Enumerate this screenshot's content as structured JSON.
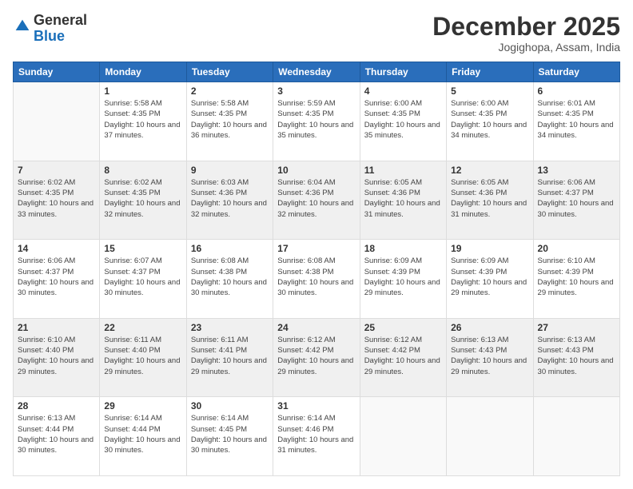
{
  "header": {
    "logo_line1": "General",
    "logo_line2": "Blue",
    "month": "December 2025",
    "location": "Jogighopa, Assam, India"
  },
  "days_of_week": [
    "Sunday",
    "Monday",
    "Tuesday",
    "Wednesday",
    "Thursday",
    "Friday",
    "Saturday"
  ],
  "weeks": [
    [
      {
        "num": "",
        "sunrise": "",
        "sunset": "",
        "daylight": ""
      },
      {
        "num": "1",
        "sunrise": "Sunrise: 5:58 AM",
        "sunset": "Sunset: 4:35 PM",
        "daylight": "Daylight: 10 hours and 37 minutes."
      },
      {
        "num": "2",
        "sunrise": "Sunrise: 5:58 AM",
        "sunset": "Sunset: 4:35 PM",
        "daylight": "Daylight: 10 hours and 36 minutes."
      },
      {
        "num": "3",
        "sunrise": "Sunrise: 5:59 AM",
        "sunset": "Sunset: 4:35 PM",
        "daylight": "Daylight: 10 hours and 35 minutes."
      },
      {
        "num": "4",
        "sunrise": "Sunrise: 6:00 AM",
        "sunset": "Sunset: 4:35 PM",
        "daylight": "Daylight: 10 hours and 35 minutes."
      },
      {
        "num": "5",
        "sunrise": "Sunrise: 6:00 AM",
        "sunset": "Sunset: 4:35 PM",
        "daylight": "Daylight: 10 hours and 34 minutes."
      },
      {
        "num": "6",
        "sunrise": "Sunrise: 6:01 AM",
        "sunset": "Sunset: 4:35 PM",
        "daylight": "Daylight: 10 hours and 34 minutes."
      }
    ],
    [
      {
        "num": "7",
        "sunrise": "Sunrise: 6:02 AM",
        "sunset": "Sunset: 4:35 PM",
        "daylight": "Daylight: 10 hours and 33 minutes."
      },
      {
        "num": "8",
        "sunrise": "Sunrise: 6:02 AM",
        "sunset": "Sunset: 4:35 PM",
        "daylight": "Daylight: 10 hours and 32 minutes."
      },
      {
        "num": "9",
        "sunrise": "Sunrise: 6:03 AM",
        "sunset": "Sunset: 4:36 PM",
        "daylight": "Daylight: 10 hours and 32 minutes."
      },
      {
        "num": "10",
        "sunrise": "Sunrise: 6:04 AM",
        "sunset": "Sunset: 4:36 PM",
        "daylight": "Daylight: 10 hours and 32 minutes."
      },
      {
        "num": "11",
        "sunrise": "Sunrise: 6:05 AM",
        "sunset": "Sunset: 4:36 PM",
        "daylight": "Daylight: 10 hours and 31 minutes."
      },
      {
        "num": "12",
        "sunrise": "Sunrise: 6:05 AM",
        "sunset": "Sunset: 4:36 PM",
        "daylight": "Daylight: 10 hours and 31 minutes."
      },
      {
        "num": "13",
        "sunrise": "Sunrise: 6:06 AM",
        "sunset": "Sunset: 4:37 PM",
        "daylight": "Daylight: 10 hours and 30 minutes."
      }
    ],
    [
      {
        "num": "14",
        "sunrise": "Sunrise: 6:06 AM",
        "sunset": "Sunset: 4:37 PM",
        "daylight": "Daylight: 10 hours and 30 minutes."
      },
      {
        "num": "15",
        "sunrise": "Sunrise: 6:07 AM",
        "sunset": "Sunset: 4:37 PM",
        "daylight": "Daylight: 10 hours and 30 minutes."
      },
      {
        "num": "16",
        "sunrise": "Sunrise: 6:08 AM",
        "sunset": "Sunset: 4:38 PM",
        "daylight": "Daylight: 10 hours and 30 minutes."
      },
      {
        "num": "17",
        "sunrise": "Sunrise: 6:08 AM",
        "sunset": "Sunset: 4:38 PM",
        "daylight": "Daylight: 10 hours and 30 minutes."
      },
      {
        "num": "18",
        "sunrise": "Sunrise: 6:09 AM",
        "sunset": "Sunset: 4:39 PM",
        "daylight": "Daylight: 10 hours and 29 minutes."
      },
      {
        "num": "19",
        "sunrise": "Sunrise: 6:09 AM",
        "sunset": "Sunset: 4:39 PM",
        "daylight": "Daylight: 10 hours and 29 minutes."
      },
      {
        "num": "20",
        "sunrise": "Sunrise: 6:10 AM",
        "sunset": "Sunset: 4:39 PM",
        "daylight": "Daylight: 10 hours and 29 minutes."
      }
    ],
    [
      {
        "num": "21",
        "sunrise": "Sunrise: 6:10 AM",
        "sunset": "Sunset: 4:40 PM",
        "daylight": "Daylight: 10 hours and 29 minutes."
      },
      {
        "num": "22",
        "sunrise": "Sunrise: 6:11 AM",
        "sunset": "Sunset: 4:40 PM",
        "daylight": "Daylight: 10 hours and 29 minutes."
      },
      {
        "num": "23",
        "sunrise": "Sunrise: 6:11 AM",
        "sunset": "Sunset: 4:41 PM",
        "daylight": "Daylight: 10 hours and 29 minutes."
      },
      {
        "num": "24",
        "sunrise": "Sunrise: 6:12 AM",
        "sunset": "Sunset: 4:42 PM",
        "daylight": "Daylight: 10 hours and 29 minutes."
      },
      {
        "num": "25",
        "sunrise": "Sunrise: 6:12 AM",
        "sunset": "Sunset: 4:42 PM",
        "daylight": "Daylight: 10 hours and 29 minutes."
      },
      {
        "num": "26",
        "sunrise": "Sunrise: 6:13 AM",
        "sunset": "Sunset: 4:43 PM",
        "daylight": "Daylight: 10 hours and 29 minutes."
      },
      {
        "num": "27",
        "sunrise": "Sunrise: 6:13 AM",
        "sunset": "Sunset: 4:43 PM",
        "daylight": "Daylight: 10 hours and 30 minutes."
      }
    ],
    [
      {
        "num": "28",
        "sunrise": "Sunrise: 6:13 AM",
        "sunset": "Sunset: 4:44 PM",
        "daylight": "Daylight: 10 hours and 30 minutes."
      },
      {
        "num": "29",
        "sunrise": "Sunrise: 6:14 AM",
        "sunset": "Sunset: 4:44 PM",
        "daylight": "Daylight: 10 hours and 30 minutes."
      },
      {
        "num": "30",
        "sunrise": "Sunrise: 6:14 AM",
        "sunset": "Sunset: 4:45 PM",
        "daylight": "Daylight: 10 hours and 30 minutes."
      },
      {
        "num": "31",
        "sunrise": "Sunrise: 6:14 AM",
        "sunset": "Sunset: 4:46 PM",
        "daylight": "Daylight: 10 hours and 31 minutes."
      },
      {
        "num": "",
        "sunrise": "",
        "sunset": "",
        "daylight": ""
      },
      {
        "num": "",
        "sunrise": "",
        "sunset": "",
        "daylight": ""
      },
      {
        "num": "",
        "sunrise": "",
        "sunset": "",
        "daylight": ""
      }
    ]
  ]
}
